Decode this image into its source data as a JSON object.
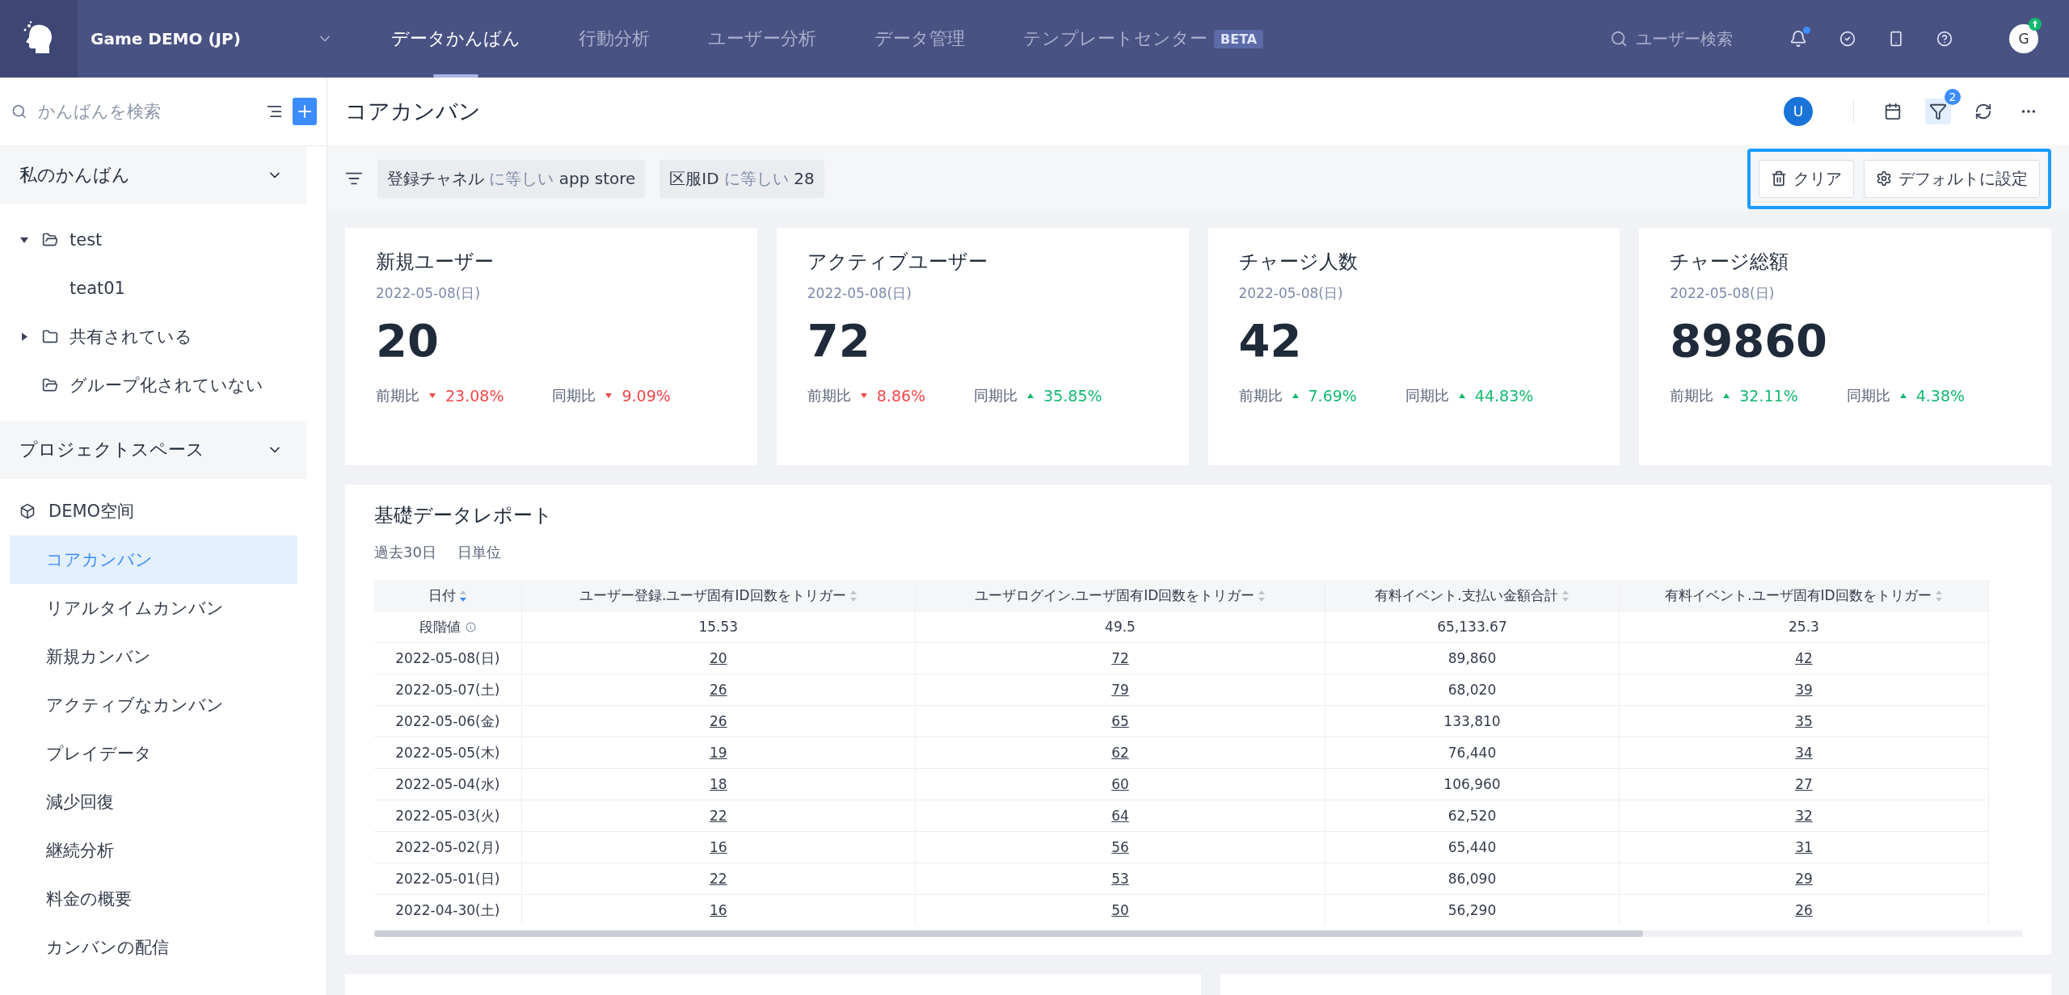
{
  "topbar": {
    "project": "Game DEMO (JP)",
    "nav": [
      {
        "label": "データかんばん",
        "selected": true
      },
      {
        "label": "行動分析",
        "selected": false
      },
      {
        "label": "ユーザー分析",
        "selected": false
      },
      {
        "label": "データ管理",
        "selected": false
      },
      {
        "label": "テンプレートセンター",
        "selected": false,
        "badge": "BETA"
      }
    ],
    "search_placeholder": "ユーザー検索",
    "notification_unread": true,
    "avatar": "G"
  },
  "sidebar": {
    "search_placeholder": "かんばんを検索",
    "sections": [
      {
        "title": "私のかんばん",
        "expanded": true,
        "kind": "folders",
        "items": [
          {
            "label": "test",
            "expanded": true,
            "children": [
              {
                "label": "teat01"
              }
            ]
          },
          {
            "label": "共有されている",
            "expanded": false
          },
          {
            "label": "グループ化されていない"
          }
        ]
      },
      {
        "title": "プロジェクトスペース",
        "expanded": true,
        "kind": "space",
        "space": "DEMO空间",
        "items": [
          {
            "label": "コアカンバン",
            "selected": true
          },
          {
            "label": "リアルタイムカンバン",
            "selected": false
          },
          {
            "label": "新規カンバン",
            "selected": false
          },
          {
            "label": "アクティブなカンバン",
            "selected": false
          },
          {
            "label": "プレイデータ",
            "selected": false
          },
          {
            "label": "減少回復",
            "selected": false
          },
          {
            "label": "継続分析",
            "selected": false
          },
          {
            "label": "料金の概要",
            "selected": false
          },
          {
            "label": "カンバンの配信",
            "selected": false
          }
        ]
      }
    ]
  },
  "header": {
    "title": "コアカンバン",
    "avatar": "U",
    "filter_count": "2"
  },
  "filters": [
    {
      "field": "登録チャネル",
      "op": "に等しい",
      "value": "app store"
    },
    {
      "field": "区服ID",
      "op": "に等しい",
      "value": "28"
    }
  ],
  "filter_buttons": [
    {
      "label": "クリア",
      "kind": "clear"
    },
    {
      "label": "デフォルトに設定",
      "kind": "default"
    }
  ],
  "metrics": [
    {
      "title": "新規ユーザー",
      "date": "2022-05-08(日)",
      "value": "20",
      "compare": [
        {
          "label": "前期比",
          "rising": false,
          "value": "23.08%"
        },
        {
          "label": "同期比",
          "rising": false,
          "value": "9.09%"
        }
      ]
    },
    {
      "title": "アクティブユーザー",
      "date": "2022-05-08(日)",
      "value": "72",
      "compare": [
        {
          "label": "前期比",
          "rising": false,
          "value": "8.86%"
        },
        {
          "label": "同期比",
          "rising": true,
          "value": "35.85%"
        }
      ]
    },
    {
      "title": "チャージ人数",
      "date": "2022-05-08(日)",
      "value": "42",
      "compare": [
        {
          "label": "前期比",
          "rising": true,
          "value": "7.69%"
        },
        {
          "label": "同期比",
          "rising": true,
          "value": "44.83%"
        }
      ]
    },
    {
      "title": "チャージ総額",
      "date": "2022-05-08(日)",
      "value": "89860",
      "compare": [
        {
          "label": "前期比",
          "rising": true,
          "value": "32.11%"
        },
        {
          "label": "同期比",
          "rising": true,
          "value": "4.38%"
        }
      ]
    }
  ],
  "report": {
    "title": "基礎データレポート",
    "tags": [
      "過去30日",
      "日単位"
    ],
    "columns": [
      {
        "label": "日付",
        "sorted_desc": true,
        "link": false
      },
      {
        "label": "ユーザー登録.ユーザ固有ID回数をトリガー",
        "sorted_desc": false,
        "link": true
      },
      {
        "label": "ユーザログイン.ユーザ固有ID回数をトリガー",
        "sorted_desc": false,
        "link": true
      },
      {
        "label": "有料イベント.支払い金額合計",
        "sorted_desc": false,
        "link": false
      },
      {
        "label": "有料イベント.ユーザ固有ID回数をトリガー",
        "sorted_desc": false,
        "link": true
      }
    ],
    "threshold": [
      "段階値",
      "15.53",
      "49.5",
      "65,133.67",
      "25.3"
    ],
    "rows": [
      [
        "2022-05-08(日)",
        "20",
        "72",
        "89,860",
        "42"
      ],
      [
        "2022-05-07(土)",
        "26",
        "79",
        "68,020",
        "39"
      ],
      [
        "2022-05-06(金)",
        "26",
        "65",
        "133,810",
        "35"
      ],
      [
        "2022-05-05(木)",
        "19",
        "62",
        "76,440",
        "34"
      ],
      [
        "2022-05-04(水)",
        "18",
        "60",
        "106,960",
        "27"
      ],
      [
        "2022-05-03(火)",
        "22",
        "64",
        "62,520",
        "32"
      ],
      [
        "2022-05-02(月)",
        "16",
        "56",
        "65,440",
        "31"
      ],
      [
        "2022-05-01(日)",
        "22",
        "53",
        "86,090",
        "29"
      ],
      [
        "2022-04-30(土)",
        "16",
        "50",
        "56,290",
        "26"
      ]
    ]
  }
}
